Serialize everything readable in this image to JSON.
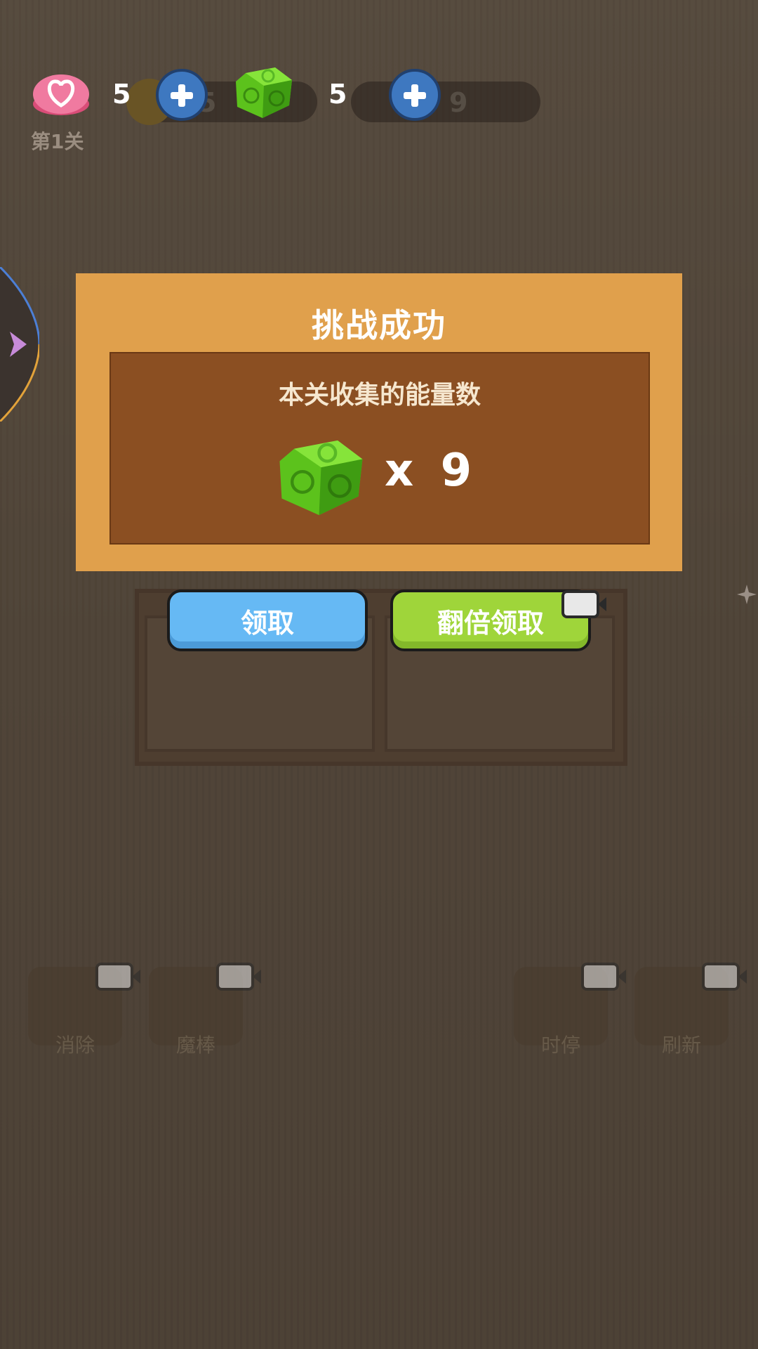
{
  "hud": {
    "level_label": "第1关",
    "lives": "5",
    "energy": "5",
    "bg_coins_partial": "5",
    "bg_energy_partial": "9"
  },
  "popup": {
    "title": "挑战成功",
    "subtitle": "本关收集的能量数",
    "reward": "x 9"
  },
  "buttons": {
    "claim": "领取",
    "double_claim": "翻倍领取"
  },
  "tools": {
    "eliminate": "消除",
    "magic_wand": "魔棒",
    "time_stop": "时停",
    "refresh": "刷新"
  },
  "icons": {
    "heart": "heart-icon",
    "energy": "energy-cube-icon",
    "video": "video-icon",
    "side_arrow": "arrow-right-icon"
  },
  "colors": {
    "popup_outer": "#e0a04c",
    "popup_inner": "#8b4f22",
    "claim_button": "#66b9f4",
    "double_button": "#9fd53a",
    "plus_button": "#3e78c0"
  }
}
